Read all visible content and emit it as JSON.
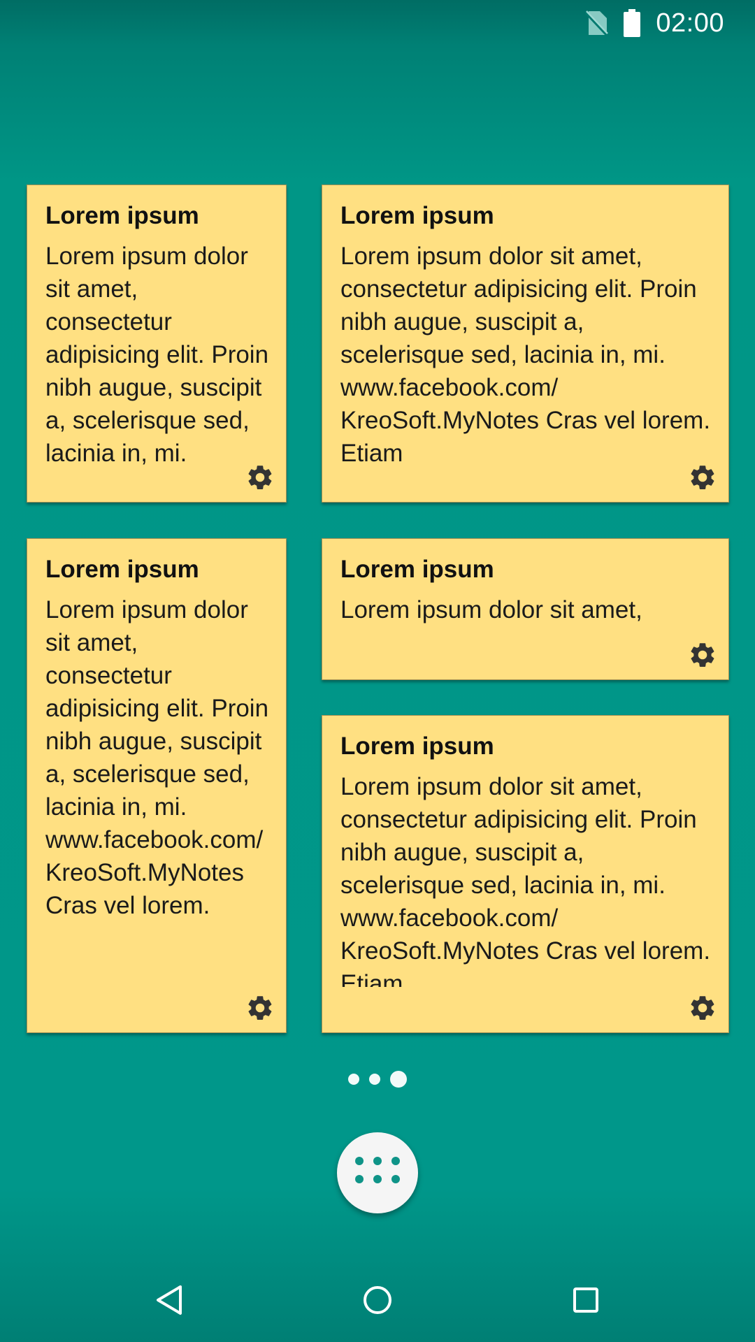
{
  "status_bar": {
    "time": "02:00",
    "icons": [
      "no-sim-icon",
      "battery-icon"
    ]
  },
  "notes": [
    {
      "title": "Lorem ipsum",
      "body": "Lorem ipsum dolor sit amet, consectetur adipisicing elit. Proin nibh augue, suscipit a, scelerisque sed, lacinia in, mi."
    },
    {
      "title": "Lorem ipsum",
      "body": "Lorem ipsum dolor sit amet, consectetur adipisicing elit. Proin nibh augue, suscipit a, scelerisque sed, lacinia in, mi. www.facebook.com/ KreoSoft.MyNotes Cras vel lorem. Etiam"
    },
    {
      "title": "Lorem ipsum",
      "body": "Lorem ipsum dolor sit amet, consectetur adipisicing elit. Proin nibh augue, suscipit a, scelerisque sed, lacinia in, mi. www.facebook.com/ KreoSoft.MyNotes Cras vel lorem."
    },
    {
      "title": "Lorem ipsum",
      "body": "Lorem ipsum dolor sit amet,"
    },
    {
      "title": "Lorem ipsum",
      "body": "Lorem ipsum dolor sit amet, consectetur adipisicing elit. Proin nibh augue, suscipit a, scelerisque sed, lacinia in, mi. www.facebook.com/ KreoSoft.MyNotes Cras vel lorem. Etiam"
    }
  ],
  "page_indicator": {
    "pages": 3,
    "active": 3
  },
  "colors": {
    "background": "#009688",
    "note": "#ffe082",
    "gear": "#333333",
    "app_drawer_dots": "#0f9488"
  },
  "nav_bar": {
    "icons": [
      "back-icon",
      "home-icon",
      "recents-icon"
    ]
  }
}
